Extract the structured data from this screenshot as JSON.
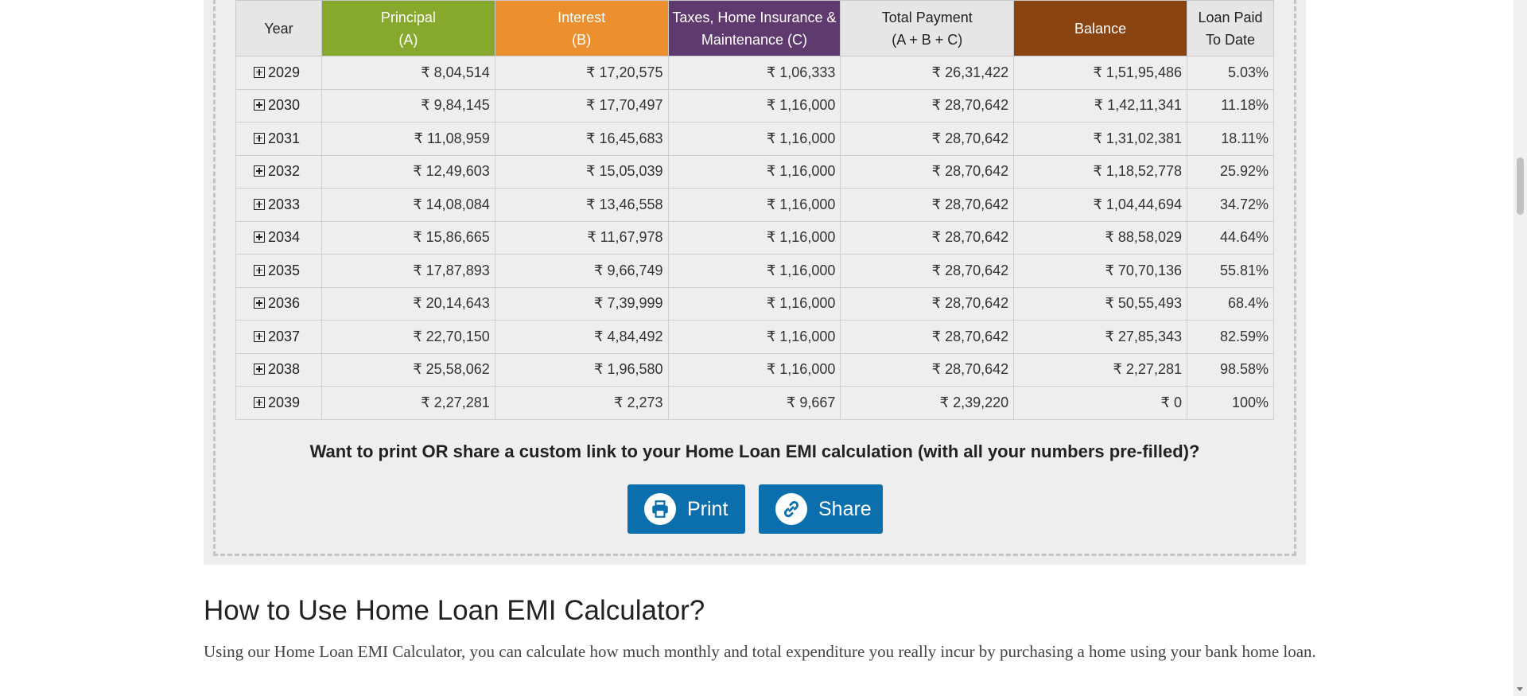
{
  "table": {
    "headers": {
      "year": "Year",
      "principal_1": "Principal",
      "principal_2": "(A)",
      "interest_1": "Interest",
      "interest_2": "(B)",
      "tax_1": "Taxes, Home Insurance &",
      "tax_2": "Maintenance (C)",
      "total_1": "Total Payment",
      "total_2": "(A + B + C)",
      "balance": "Balance",
      "paid_1": "Loan Paid",
      "paid_2": "To Date"
    },
    "rows": [
      {
        "year": "2029",
        "principal": "₹ 8,04,514",
        "interest": "₹ 17,20,575",
        "tax": "₹ 1,06,333",
        "total": "₹ 26,31,422",
        "balance": "₹ 1,51,95,486",
        "paid": "5.03%"
      },
      {
        "year": "2030",
        "principal": "₹ 9,84,145",
        "interest": "₹ 17,70,497",
        "tax": "₹ 1,16,000",
        "total": "₹ 28,70,642",
        "balance": "₹ 1,42,11,341",
        "paid": "11.18%"
      },
      {
        "year": "2031",
        "principal": "₹ 11,08,959",
        "interest": "₹ 16,45,683",
        "tax": "₹ 1,16,000",
        "total": "₹ 28,70,642",
        "balance": "₹ 1,31,02,381",
        "paid": "18.11%"
      },
      {
        "year": "2032",
        "principal": "₹ 12,49,603",
        "interest": "₹ 15,05,039",
        "tax": "₹ 1,16,000",
        "total": "₹ 28,70,642",
        "balance": "₹ 1,18,52,778",
        "paid": "25.92%"
      },
      {
        "year": "2033",
        "principal": "₹ 14,08,084",
        "interest": "₹ 13,46,558",
        "tax": "₹ 1,16,000",
        "total": "₹ 28,70,642",
        "balance": "₹ 1,04,44,694",
        "paid": "34.72%"
      },
      {
        "year": "2034",
        "principal": "₹ 15,86,665",
        "interest": "₹ 11,67,978",
        "tax": "₹ 1,16,000",
        "total": "₹ 28,70,642",
        "balance": "₹ 88,58,029",
        "paid": "44.64%"
      },
      {
        "year": "2035",
        "principal": "₹ 17,87,893",
        "interest": "₹ 9,66,749",
        "tax": "₹ 1,16,000",
        "total": "₹ 28,70,642",
        "balance": "₹ 70,70,136",
        "paid": "55.81%"
      },
      {
        "year": "2036",
        "principal": "₹ 20,14,643",
        "interest": "₹ 7,39,999",
        "tax": "₹ 1,16,000",
        "total": "₹ 28,70,642",
        "balance": "₹ 50,55,493",
        "paid": "68.4%"
      },
      {
        "year": "2037",
        "principal": "₹ 22,70,150",
        "interest": "₹ 4,84,492",
        "tax": "₹ 1,16,000",
        "total": "₹ 28,70,642",
        "balance": "₹ 27,85,343",
        "paid": "82.59%"
      },
      {
        "year": "2038",
        "principal": "₹ 25,58,062",
        "interest": "₹ 1,96,580",
        "tax": "₹ 1,16,000",
        "total": "₹ 28,70,642",
        "balance": "₹ 2,27,281",
        "paid": "98.58%"
      },
      {
        "year": "2039",
        "principal": "₹ 2,27,281",
        "interest": "₹ 2,273",
        "tax": "₹ 9,667",
        "total": "₹ 2,39,220",
        "balance": "₹ 0",
        "paid": "100%"
      }
    ]
  },
  "cta": {
    "text": "Want to print OR share a custom link to your Home Loan EMI calculation (with all your numbers pre-filled)?",
    "print_label": "Print",
    "share_label": "Share"
  },
  "howto": {
    "title": "How to Use Home Loan EMI Calculator?",
    "body": "Using our Home Loan EMI Calculator, you can calculate how much monthly and total expenditure you really incur by purchasing a home using your bank home loan."
  },
  "icons": {
    "expand": "plus-square-icon",
    "print": "printer-icon",
    "share": "link-icon"
  },
  "colors": {
    "principal": "#86a82d",
    "interest": "#ec8f2f",
    "tax": "#5f3a6e",
    "balance": "#8a4411",
    "button": "#0b6fae"
  }
}
